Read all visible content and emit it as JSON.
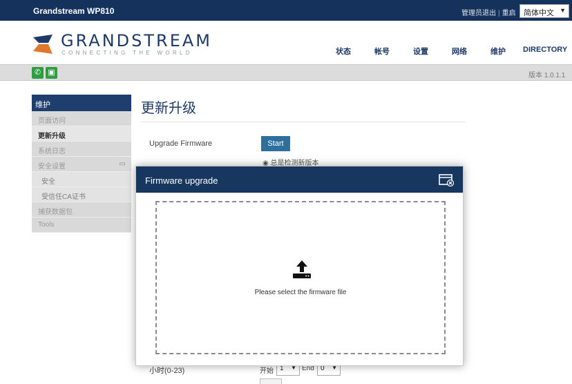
{
  "topbar": {
    "product": "Grandstream WP810",
    "admin_logout": "管理员退出",
    "restart": "重启",
    "separator": "|",
    "language": "简体中文"
  },
  "brand": {
    "name": "GRANDSTREAM",
    "tagline": "CONNECTING THE WORLD",
    "color": "#1f3a66"
  },
  "nav": {
    "status": "状态",
    "account": "帐号",
    "settings": "设置",
    "network": "网络",
    "maintenance": "维护",
    "directory": "DIRECTORY"
  },
  "subbar": {
    "version": "版本 1.0.1.1",
    "icon_color": "#2e9e43"
  },
  "sidebar": {
    "header": "维护",
    "items": [
      {
        "label": "页面访问"
      },
      {
        "label": "更新升级"
      },
      {
        "label": "系统日志"
      },
      {
        "label": "安全设置"
      },
      {
        "label": "安全"
      },
      {
        "label": "受信任CA证书"
      },
      {
        "label": "捕获数据包"
      },
      {
        "label": "Tools"
      }
    ]
  },
  "main": {
    "title": "更新升级",
    "upgrade_firmware_label": "Upgrade Firmware",
    "start_button": "Start",
    "radio_always_check": "总是检测新版本",
    "hour_label": "小时(0-23)",
    "start_label": "开始",
    "start_value": "1",
    "end_label": "End",
    "end_value": "0"
  },
  "modal": {
    "title": "Firmware upgrade",
    "drop_text": "Please select the firmware file",
    "header_color": "#17375f"
  }
}
